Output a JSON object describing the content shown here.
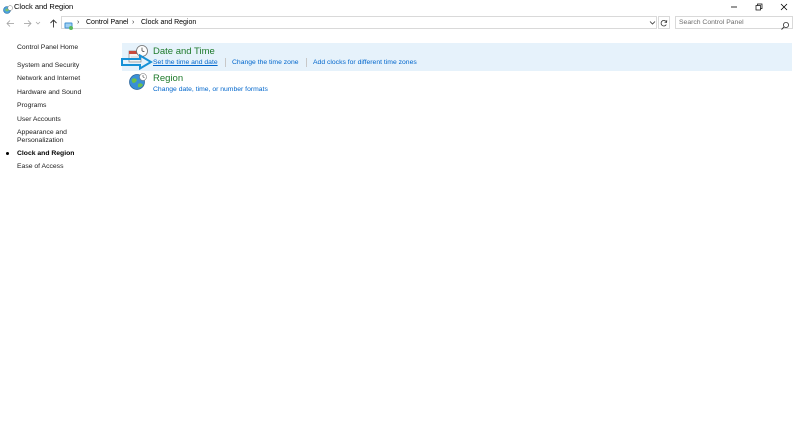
{
  "window": {
    "title": "Clock and Region"
  },
  "address": {
    "segments": [
      "Control Panel",
      "Clock and Region"
    ],
    "search_placeholder": "Search Control Panel"
  },
  "sidebar": {
    "home": "Control Panel Home",
    "items": [
      {
        "label": "System and Security"
      },
      {
        "label": "Network and Internet"
      },
      {
        "label": "Hardware and Sound"
      },
      {
        "label": "Programs"
      },
      {
        "label": "User Accounts"
      },
      {
        "label": "Appearance and Personalization"
      },
      {
        "label": "Clock and Region",
        "active": true
      },
      {
        "label": "Ease of Access"
      }
    ]
  },
  "categories": [
    {
      "title": "Date and Time",
      "icon": "clock-calendar-icon",
      "links": [
        "Set the time and date",
        "Change the time zone",
        "Add clocks for different time zones"
      ]
    },
    {
      "title": "Region",
      "icon": "globe-icon",
      "links": [
        "Change date, time, or number formats"
      ]
    }
  ],
  "colors": {
    "highlight": "#e6f2fb",
    "category_title": "#1e7a2b",
    "link": "#0066cc",
    "annotation_arrow": "#1791d6"
  },
  "icons": [
    "app-icon",
    "minimize-icon",
    "restore-icon",
    "close-icon",
    "back-arrow-icon",
    "forward-arrow-icon",
    "recent-chevron-icon",
    "up-arrow-icon",
    "control-panel-icon",
    "dropdown-chevron-icon",
    "refresh-icon",
    "search-icon"
  ]
}
